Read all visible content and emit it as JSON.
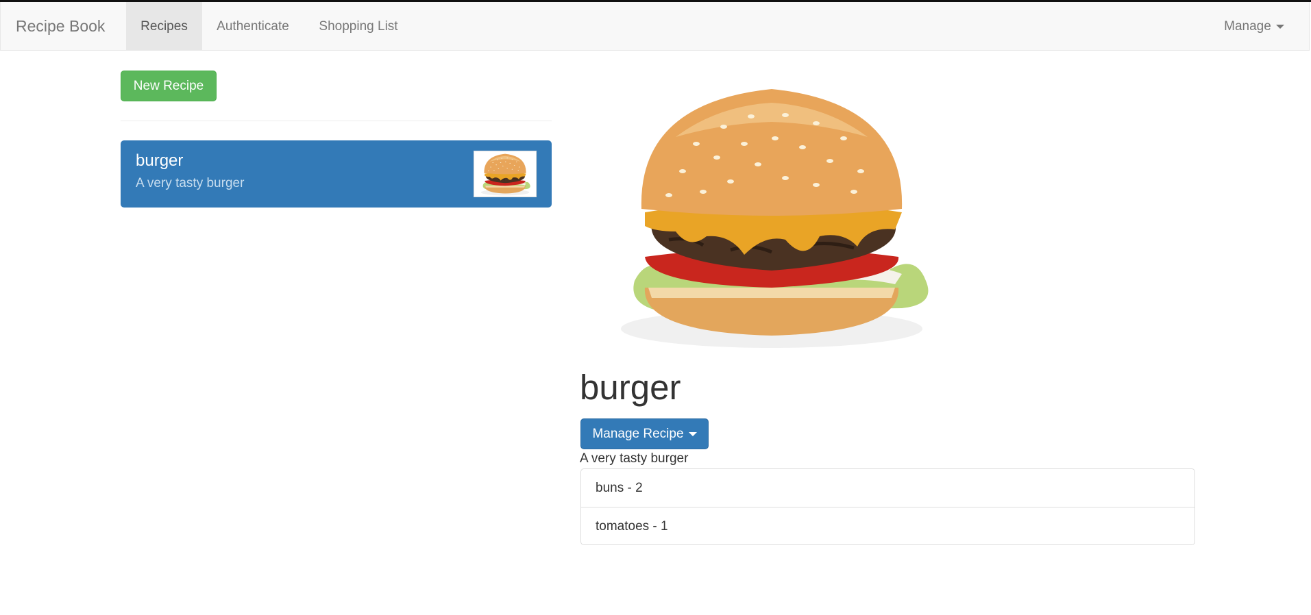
{
  "navbar": {
    "brand": "Recipe Book",
    "items": [
      {
        "label": "Recipes",
        "active": true
      },
      {
        "label": "Authenticate",
        "active": false
      },
      {
        "label": "Shopping List",
        "active": false
      }
    ],
    "manage_label": "Manage"
  },
  "recipe_list": {
    "new_button_label": "New Recipe",
    "items": [
      {
        "name": "burger",
        "description": "A very tasty burger",
        "image": "burger-photo"
      }
    ]
  },
  "detail": {
    "image": "burger-photo",
    "title": "burger",
    "manage_button_label": "Manage Recipe",
    "description": "A very tasty burger",
    "ingredients": [
      "buns - 2",
      "tomatoes - 1"
    ]
  },
  "colors": {
    "primary": "#337ab7",
    "success": "#5cb85c",
    "navbar_bg": "#f8f8f8",
    "nav_active_bg": "#e7e7e7"
  }
}
